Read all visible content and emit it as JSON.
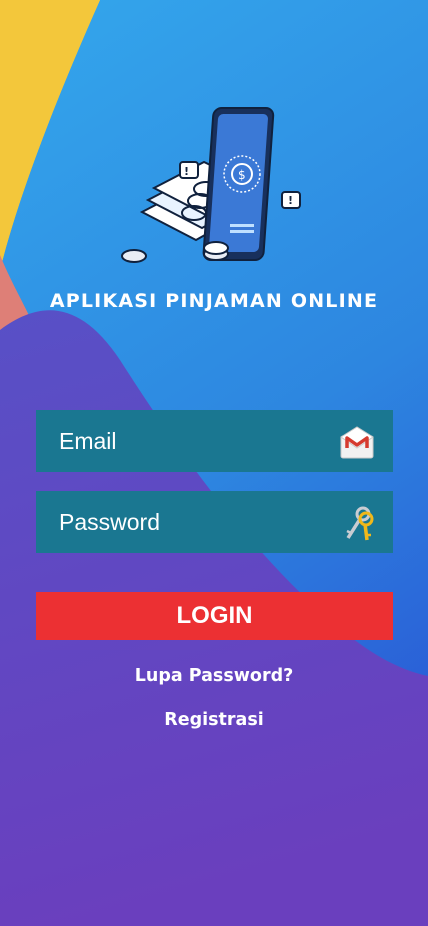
{
  "app": {
    "title": "APLIKASI PINJAMAN ONLINE"
  },
  "form": {
    "email_placeholder": "Email",
    "password_placeholder": "Password",
    "login_label": "LOGIN",
    "forgot_password_label": "Lupa Password?",
    "register_label": "Registrasi"
  },
  "icons": {
    "email": "gmail-envelope-icon",
    "password": "keys-icon",
    "logo": "phone-money-illustration"
  },
  "colors": {
    "background_top": "#2f9fe6",
    "background_bottom": "#6b3fbf",
    "input_bg": "#1a7791",
    "login_button": "#ec3033",
    "accent_yellow": "#f3c73b"
  }
}
